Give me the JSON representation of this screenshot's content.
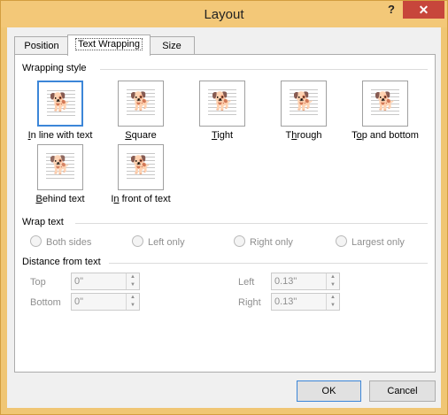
{
  "window": {
    "title": "Layout",
    "help": "?",
    "close": "✕"
  },
  "tabs": [
    {
      "label": "Position",
      "active": false
    },
    {
      "label": "Text Wrapping",
      "active": true
    },
    {
      "label": "Size",
      "active": false
    }
  ],
  "wrapping_style": {
    "heading": "Wrapping style",
    "options": [
      {
        "key": "I",
        "rest": "n line with text",
        "selected": true,
        "icon": "inline-with-text-icon"
      },
      {
        "key": "S",
        "rest": "quare",
        "icon": "square-icon"
      },
      {
        "key": "T",
        "rest": "ight",
        "icon": "tight-icon"
      },
      {
        "pre": "T",
        "key": "h",
        "rest": "rough",
        "icon": "through-icon"
      },
      {
        "pre": "T",
        "key": "o",
        "rest": "p and bottom",
        "icon": "top-and-bottom-icon"
      },
      {
        "key": "B",
        "rest": "ehind text",
        "icon": "behind-text-icon"
      },
      {
        "pre": "I",
        "key": "n",
        "rest": " front of text",
        "icon": "in-front-of-text-icon"
      }
    ]
  },
  "wrap_text": {
    "heading": "Wrap text",
    "options": [
      "Both sides",
      "Left only",
      "Right only",
      "Largest only"
    ]
  },
  "distance": {
    "heading": "Distance from text",
    "top_label": "Top",
    "top_value": "0\"",
    "bottom_label": "Bottom",
    "bottom_value": "0\"",
    "left_label": "Left",
    "left_value": "0.13\"",
    "right_label": "Right",
    "right_value": "0.13\""
  },
  "buttons": {
    "ok": "OK",
    "cancel": "Cancel"
  }
}
